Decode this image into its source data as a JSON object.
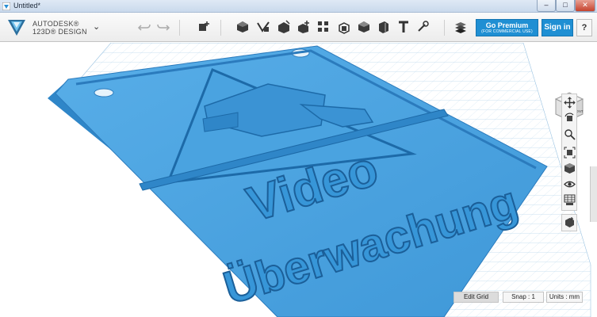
{
  "window": {
    "title": "Untitled*",
    "controls": {
      "minimize": "–",
      "maximize": "□",
      "close": "✕"
    }
  },
  "brand": {
    "line1": "AUTODESK®",
    "line2": "123D® DESIGN",
    "logo_icon": "autodesk-123d-logo"
  },
  "toolbar": {
    "tools": [
      {
        "name": "undo-icon"
      },
      {
        "name": "redo-icon"
      },
      {
        "name": "transform-icon"
      },
      {
        "name": "primitives-icon"
      },
      {
        "name": "sketch-icon"
      },
      {
        "name": "construct-icon"
      },
      {
        "name": "modify-icon"
      },
      {
        "name": "pattern-icon"
      },
      {
        "name": "group-icon"
      },
      {
        "name": "combine-icon"
      },
      {
        "name": "measure-icon"
      },
      {
        "name": "text-icon"
      },
      {
        "name": "snap-icon"
      },
      {
        "name": "material-icon"
      }
    ],
    "premium_title": "Go Premium",
    "premium_subtitle": "(FOR COMMERCIAL USE)",
    "signin": "Sign in",
    "help": "?"
  },
  "viewcube": {
    "top": "TOP",
    "front": "FRONT"
  },
  "model_text": {
    "line1": "Video",
    "line2": "Überwachung"
  },
  "status": {
    "edit_grid": "Edit Grid",
    "snap": "Snap :  1",
    "units": "Units : mm"
  },
  "colors": {
    "accent": "#1f8fd3",
    "model": "#4ba3e2",
    "grid": "#b9d7ec"
  }
}
